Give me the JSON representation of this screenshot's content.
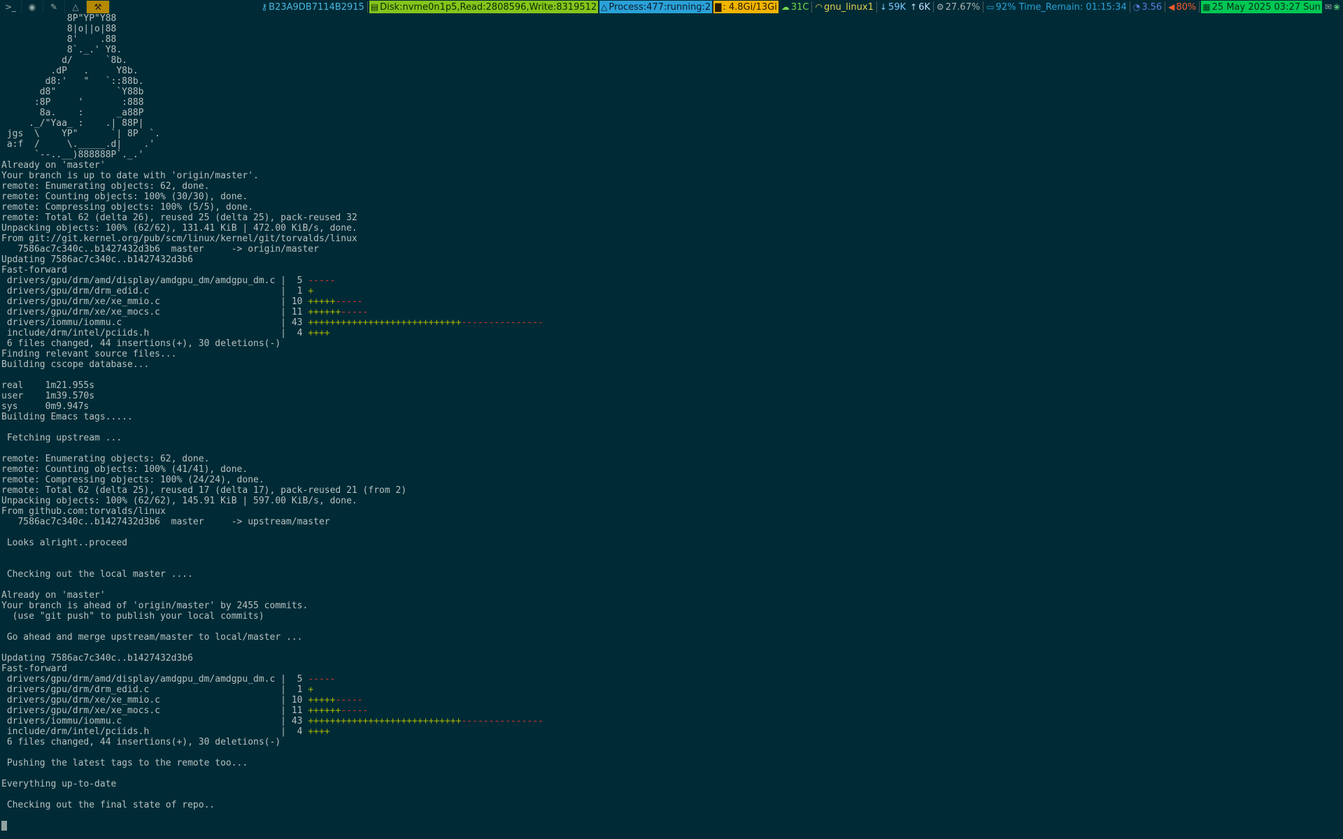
{
  "topbar": {
    "workspaces": [
      {
        "name": "terminal-icon",
        "glyph": ">_",
        "active": false
      },
      {
        "name": "firefox-icon",
        "glyph": "◉",
        "active": false
      },
      {
        "name": "editor-icon",
        "glyph": "✎",
        "active": false
      },
      {
        "name": "tux-icon",
        "glyph": "△",
        "active": false
      },
      {
        "name": "tools-icon",
        "glyph": "⚒",
        "active": true
      }
    ],
    "status": {
      "key": "B23A9DB7114B2915",
      "disk": "Disk:nvme0n1p5,Read:2808596,Write:8319512",
      "process": "Process:477:running:2",
      "memory": ": 4.8Gi/13Gi",
      "temperature": "31C",
      "wifi": "gnu_linux1",
      "download": "59K",
      "upload": "6K",
      "cpu": "27.67%",
      "battery": "92% Time_Remain: 01:15:34",
      "load": "3.56",
      "volume": "80%",
      "datetime": "25 May 2025 03:27 Sun"
    },
    "colors": {
      "disk_bg": "#85c51b",
      "process_bg": "#2aa1d8",
      "memory_bg": "#f2b400",
      "date_bg": "#00c853",
      "active_ws_bg": "#b58900"
    }
  },
  "terminal": {
    "background": "#002b36",
    "lines": [
      "            8P\"YP\"Y88",
      "            8|o||o|88",
      "            8'    .88",
      "            8`._.' Y8.",
      "           d/      `8b.",
      "         .dP   .     Y8b.",
      "        d8:'   \"   `::88b.",
      "       d8\"           `Y88b",
      "      :8P     '       :888",
      "       8a.    :      _a88P",
      "     ._/\"Yaa_ :    .| 88P|",
      " jgs  \\    YP\"      `| 8P  `.",
      " a:f  /     \\._____.d|    .'",
      "      `--..__)888888P`._.'",
      "Already on 'master'",
      "Your branch is up to date with 'origin/master'.",
      "remote: Enumerating objects: 62, done.",
      "remote: Counting objects: 100% (30/30), done.",
      "remote: Compressing objects: 100% (5/5), done.",
      "remote: Total 62 (delta 26), reused 25 (delta 25), pack-reused 32",
      "Unpacking objects: 100% (62/62), 131.41 KiB | 472.00 KiB/s, done.",
      "From git://git.kernel.org/pub/scm/linux/kernel/git/torvalds/linux",
      "   7586ac7c340c..b1427432d3b6  master     -> origin/master",
      "Updating 7586ac7c340c..b1427432d3b6",
      "Fast-forward",
      {
        "file": " drivers/gpu/drm/amd/display/amdgpu_dm/amdgpu_dm.c | ",
        "count": " 5 ",
        "plus": "",
        "minus": "-----"
      },
      {
        "file": " drivers/gpu/drm/drm_edid.c                        | ",
        "count": " 1 ",
        "plus": "+",
        "minus": ""
      },
      {
        "file": " drivers/gpu/drm/xe/xe_mmio.c                      | ",
        "count": "10 ",
        "plus": "+++++",
        "minus": "-----"
      },
      {
        "file": " drivers/gpu/drm/xe/xe_mocs.c                      | ",
        "count": "11 ",
        "plus": "++++++",
        "minus": "-----"
      },
      {
        "file": " drivers/iommu/iommu.c                             | ",
        "count": "43 ",
        "plus": "++++++++++++++++++++++++++++",
        "minus": "---------------"
      },
      {
        "file": " include/drm/intel/pciids.h                        | ",
        "count": " 4 ",
        "plus": "++++",
        "minus": ""
      },
      " 6 files changed, 44 insertions(+), 30 deletions(-)",
      "Finding relevant source files...",
      "Building cscope database...",
      "",
      "real    1m21.955s",
      "user    1m39.570s",
      "sys     0m9.947s",
      "Building Emacs tags.....",
      "",
      " Fetching upstream ...",
      "",
      "remote: Enumerating objects: 62, done.",
      "remote: Counting objects: 100% (41/41), done.",
      "remote: Compressing objects: 100% (24/24), done.",
      "remote: Total 62 (delta 25), reused 17 (delta 17), pack-reused 21 (from 2)",
      "Unpacking objects: 100% (62/62), 145.91 KiB | 597.00 KiB/s, done.",
      "From github.com:torvalds/linux",
      "   7586ac7c340c..b1427432d3b6  master     -> upstream/master",
      "",
      " Looks alright..proceed",
      "",
      "",
      " Checking out the local master ....",
      "",
      "Already on 'master'",
      "Your branch is ahead of 'origin/master' by 2455 commits.",
      "  (use \"git push\" to publish your local commits)",
      "",
      " Go ahead and merge upstream/master to local/master ...",
      "",
      "Updating 7586ac7c340c..b1427432d3b6",
      "Fast-forward",
      {
        "file": " drivers/gpu/drm/amd/display/amdgpu_dm/amdgpu_dm.c | ",
        "count": " 5 ",
        "plus": "",
        "minus": "-----"
      },
      {
        "file": " drivers/gpu/drm/drm_edid.c                        | ",
        "count": " 1 ",
        "plus": "+",
        "minus": ""
      },
      {
        "file": " drivers/gpu/drm/xe/xe_mmio.c                      | ",
        "count": "10 ",
        "plus": "+++++",
        "minus": "-----"
      },
      {
        "file": " drivers/gpu/drm/xe/xe_mocs.c                      | ",
        "count": "11 ",
        "plus": "++++++",
        "minus": "-----"
      },
      {
        "file": " drivers/iommu/iommu.c                             | ",
        "count": "43 ",
        "plus": "++++++++++++++++++++++++++++",
        "minus": "---------------"
      },
      {
        "file": " include/drm/intel/pciids.h                        | ",
        "count": " 4 ",
        "plus": "++++",
        "minus": ""
      },
      " 6 files changed, 44 insertions(+), 30 deletions(-)",
      "",
      " Pushing the latest tags to the remote too...",
      "",
      "Everything up-to-date",
      "",
      " Checking out the final state of repo..",
      ""
    ]
  }
}
